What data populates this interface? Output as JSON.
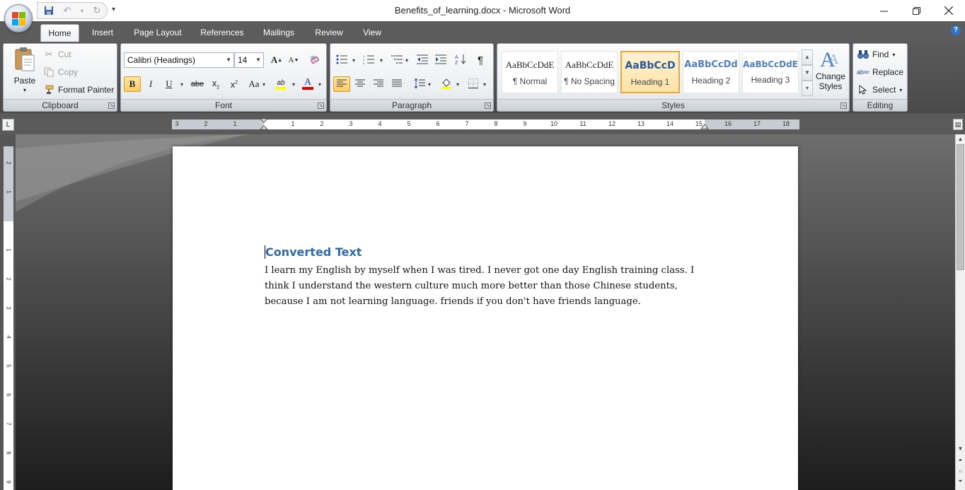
{
  "window": {
    "title": "Benefits_of_learning.docx - Microsoft Word",
    "controls": [
      "minimize-icon",
      "restore-icon",
      "close-icon"
    ]
  },
  "quick_access": {
    "icons": [
      "save-icon",
      "undo-icon",
      "redo-icon",
      "customize-icon"
    ]
  },
  "tabs": [
    "Home",
    "Insert",
    "Page Layout",
    "References",
    "Mailings",
    "Review",
    "View"
  ],
  "active_tab": "Home",
  "clipboard": {
    "group_label": "Clipboard",
    "paste": "Paste",
    "cut": "Cut",
    "copy": "Copy",
    "format_painter": "Format Painter"
  },
  "font": {
    "group_label": "Font",
    "family": "Calibri (Headings)",
    "size": "14",
    "grow": "A",
    "shrink": "A",
    "bold": "B",
    "italic": "I",
    "underline": "U",
    "strike": "abe",
    "change_case": "Aa",
    "color_letter": "A",
    "highlight_letters": "ab",
    "highlight_color": "#ffff00",
    "font_color": "#e00000"
  },
  "paragraph": {
    "group_label": "Paragraph",
    "show_hide": "¶",
    "active_alignment": "left"
  },
  "styles": {
    "group_label": "Styles",
    "items": [
      {
        "preview": "AaBbCcDdE",
        "name": "¶ Normal"
      },
      {
        "preview": "AaBbCcDdE",
        "name": "¶ No Spacing"
      },
      {
        "preview": "AaBbCcD",
        "name": "Heading 1"
      },
      {
        "preview": "AaBbCcDd",
        "name": "Heading 2"
      },
      {
        "preview": "AaBbCcDdE",
        "name": "Heading 3"
      }
    ],
    "selected": "Heading 1",
    "change_styles": "Change Styles"
  },
  "editing": {
    "group_label": "Editing",
    "find": "Find",
    "replace": "Replace",
    "select": "Select"
  },
  "ruler": {
    "numbers": [
      "3",
      "2",
      "1",
      "1",
      "2",
      "3",
      "4",
      "5",
      "6",
      "7",
      "8",
      "9",
      "10",
      "11",
      "12",
      "13",
      "14",
      "15",
      "16",
      "17",
      "18"
    ]
  },
  "vertical_ruler": {
    "numbers": [
      "2",
      "1",
      "1",
      "2",
      "3",
      "4",
      "5",
      "6",
      "7",
      "8",
      "9"
    ]
  },
  "document": {
    "heading": "Converted Text",
    "body": "I learn my English by myself when I was tired. I never got one day English training class. I think I understand the western culture much more better than those Chinese students, because I am not learning language. friends if you don't have friends language."
  }
}
